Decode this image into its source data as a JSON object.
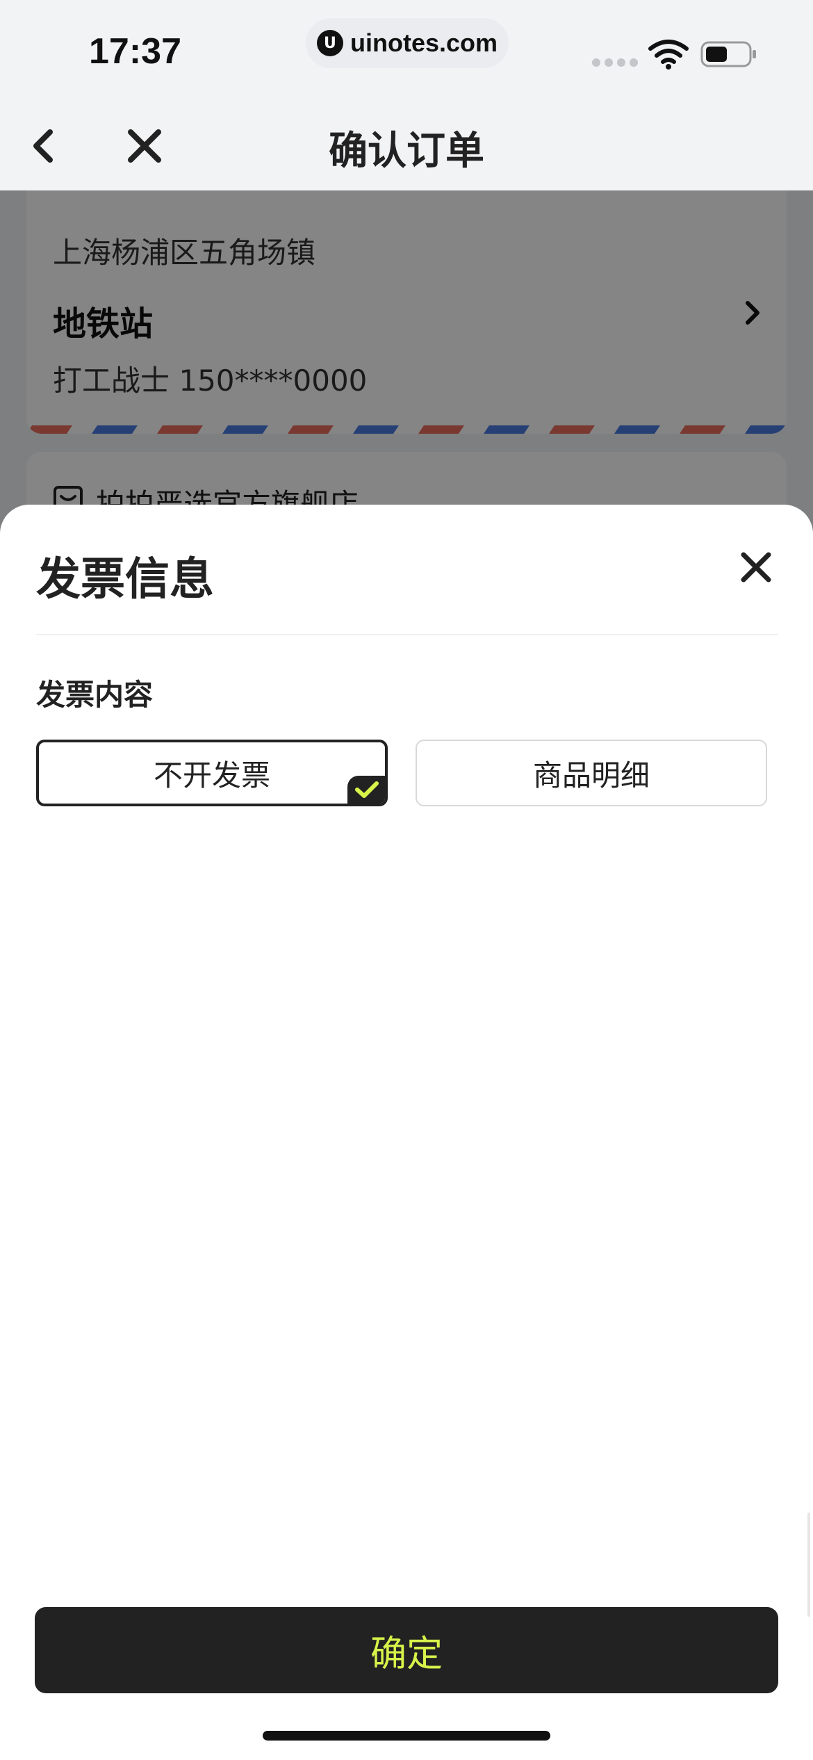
{
  "status_bar": {
    "time": "17:37",
    "url": "uinotes.com",
    "url_logo_glyph": "U"
  },
  "nav": {
    "title": "确认订单",
    "back_icon": "chevron-left-icon",
    "close_icon": "close-icon"
  },
  "address": {
    "region": "上海杨浦区五角场镇",
    "detail": "地铁站",
    "contact": "打工战士   150****0000"
  },
  "shop": {
    "name": "拍拍严选官方旗舰店"
  },
  "invoice_sheet": {
    "title": "发票信息",
    "section_label": "发票内容",
    "options": [
      {
        "label": "不开发票",
        "selected": true
      },
      {
        "label": "商品明细",
        "selected": false
      }
    ],
    "confirm_label": "确定"
  },
  "colors": {
    "accent_text": "#d8f34a",
    "button_bg": "#222222",
    "stripe_red": "#e86c5c",
    "stripe_blue": "#4a7be0"
  }
}
